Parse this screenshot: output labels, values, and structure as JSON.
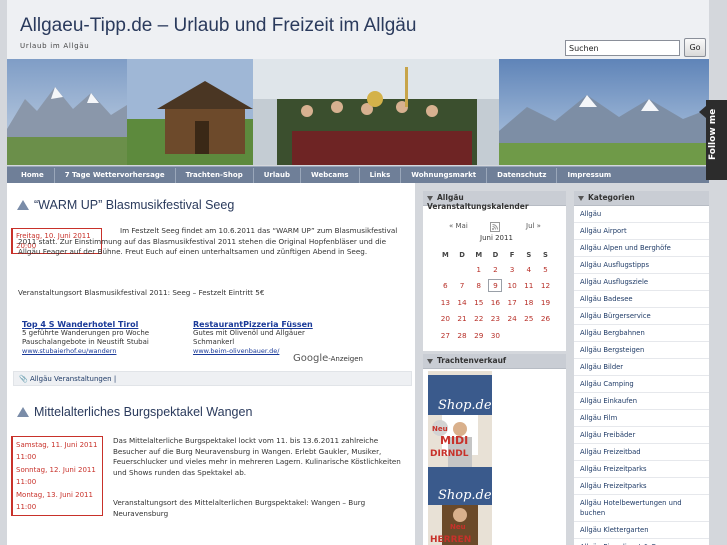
{
  "header": {
    "title": "Allgaeu-Tipp.de – Urlaub und Freizeit im Allgäu",
    "description": "Urlaub im Allgäu",
    "search_value": "Suchen",
    "search_button": "Go"
  },
  "nav": [
    "Home",
    "7 Tage Wettervorhersage",
    "Trachten-Shop",
    "Urlaub",
    "Webcams",
    "Links",
    "Wohnungsmarkt",
    "Datenschutz",
    "Impressum"
  ],
  "follow": "Follow me",
  "posts": [
    {
      "title": "“WARM UP” Blasmusikfestival Seeg",
      "dates": [
        [
          "Freitag, 10. Juni 2011",
          "20:00"
        ]
      ],
      "text": "Im Festzelt Seeg findet am 10.6.2011 das “WARM UP” zum Blasmusikfestival 2011 statt. Zur Einstimmung auf das Blasmusikfestival 2011 stehen die Original Hopfenbläser und die Allgäu Feager auf der Bühne. Freut Euch auf einen unterhaltsamen und zünftigen Abend in Seeg.",
      "location": "Veranstaltungsort Blasmusikfestival 2011: Seeg – Festzelt Eintritt 5€",
      "category": "Allgäu Veranstaltungen |"
    },
    {
      "title": "Mittelalterliches Burgspektakel Wangen",
      "dates": [
        [
          "Samstag, 11. Juni 2011",
          "11:00"
        ],
        [
          "Sonntag, 12. Juni 2011",
          "11:00"
        ],
        [
          "Montag, 13. Juni 2011",
          "11:00"
        ]
      ],
      "text": "Das Mittelalterliche Burgspektakel lockt vom 11. bis 13.6.2011 zahlreiche Besucher auf die Burg Neuravensburg in Wangen. Erlebt Gaukler, Musiker, Feuerschlucker und vieles mehr in mehreren Lagern. Kulinarische Köstlichkeiten und Shows runden das Spektakel ab.",
      "location": "Veranstaltungsort des Mittelalterlichen Burgspektakel: Wangen – Burg Neuravensburg"
    }
  ],
  "ads": [
    {
      "title": "Top 4 S Wanderhotel Tirol",
      "desc": "5 geführte Wanderungen pro Woche Pauschalangebote in Neustift Stubai",
      "url": "www.stubaierhof.eu/wandern"
    },
    {
      "title": "RestaurantPizzeria Füssen",
      "desc": "Gutes mit Olivenöl und Allgäuer Schmankerl",
      "url": "www.beim-olivenbauer.de/"
    }
  ],
  "google_ads": {
    "brand": "Google",
    "suffix": "-Anzeigen"
  },
  "calendar": {
    "heading": "Allgäu Veranstaltungskalender",
    "prev": "« Mai",
    "next": "Jul »",
    "month": "Juni 2011",
    "weekdays": [
      "M",
      "D",
      "M",
      "D",
      "F",
      "S",
      "S"
    ],
    "weeks": [
      [
        "",
        "",
        "1",
        "2",
        "3",
        "4",
        "5"
      ],
      [
        "6",
        "7",
        "8",
        "9",
        "10",
        "11",
        "12"
      ],
      [
        "13",
        "14",
        "15",
        "16",
        "17",
        "18",
        "19"
      ],
      [
        "20",
        "21",
        "22",
        "23",
        "24",
        "25",
        "26"
      ],
      [
        "27",
        "28",
        "29",
        "30",
        "",
        "",
        ""
      ]
    ],
    "today": "9"
  },
  "trachten": {
    "heading": "Trachtenverkauf",
    "shop_text_1": "Shop.de",
    "neu": "Neu",
    "midi": "MIDI",
    "dirndl": "DIRNDL",
    "herren": "HERREN"
  },
  "categories": {
    "heading": "Kategorien",
    "items": [
      "Allgäu",
      "Allgäu Airport",
      "Allgäu Alpen und Berghöfe",
      "Allgäu Ausflugstipps",
      "Allgäu Ausflugsziele",
      "Allgäu Badesee",
      "Allgäu Bürgerservice",
      "Allgäu Bergbahnen",
      "Allgäu Bergsteigen",
      "Allgäu Bilder",
      "Allgäu Camping",
      "Allgäu Einkaufen",
      "Allgäu Film",
      "Allgäu Freibäder",
      "Allgäu Freizeitbad",
      "Allgäu Freizeitparks",
      "Allgäu Freizeitparks",
      "Allgäu Hotelbewertungen und buchen",
      "Allgäu Klettergarten",
      "Allgäu Pizzadienst & Co."
    ]
  },
  "colors": {
    "accent": "#c8312a",
    "nav": "#6f7f98",
    "title": "#2a3a5c"
  }
}
